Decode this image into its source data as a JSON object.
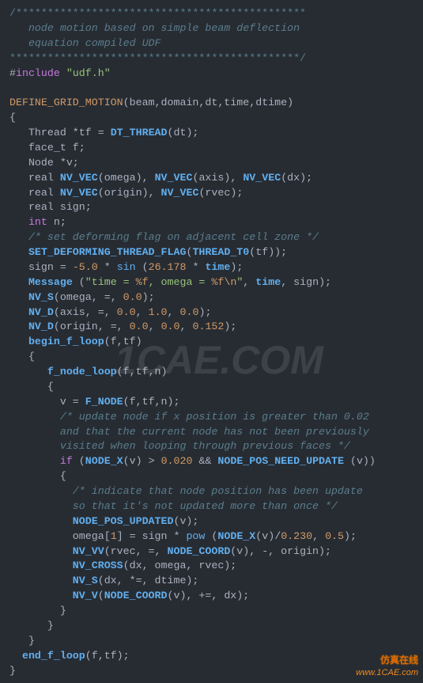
{
  "watermark": {
    "big": "1CAE.COM",
    "footer_cn": "仿真在线",
    "footer_url": "www.1CAE.com"
  },
  "code": {
    "l1": "/**********************************************",
    "l2": "   node motion based on simple beam deflection",
    "l3": "   equation compiled UDF",
    "l4": "**********************************************/",
    "l5a": "include",
    "l5b": "\"udf.h\"",
    "l7a": "DEFINE_GRID_MOTION",
    "l7b": "(beam,domain,dt,time,dtime)",
    "l9a": "DT_THREAD",
    "l16": "/* set deforming flag on adjacent cell zone */",
    "l28": "/* update node if x position is greater than 0.02",
    "l29": "and that the current node has not been previously",
    "l30": "visited when looping through previous faces */",
    "l33": "/* indicate that node position has been update",
    "l34": "so that it's not updated more than once */"
  }
}
